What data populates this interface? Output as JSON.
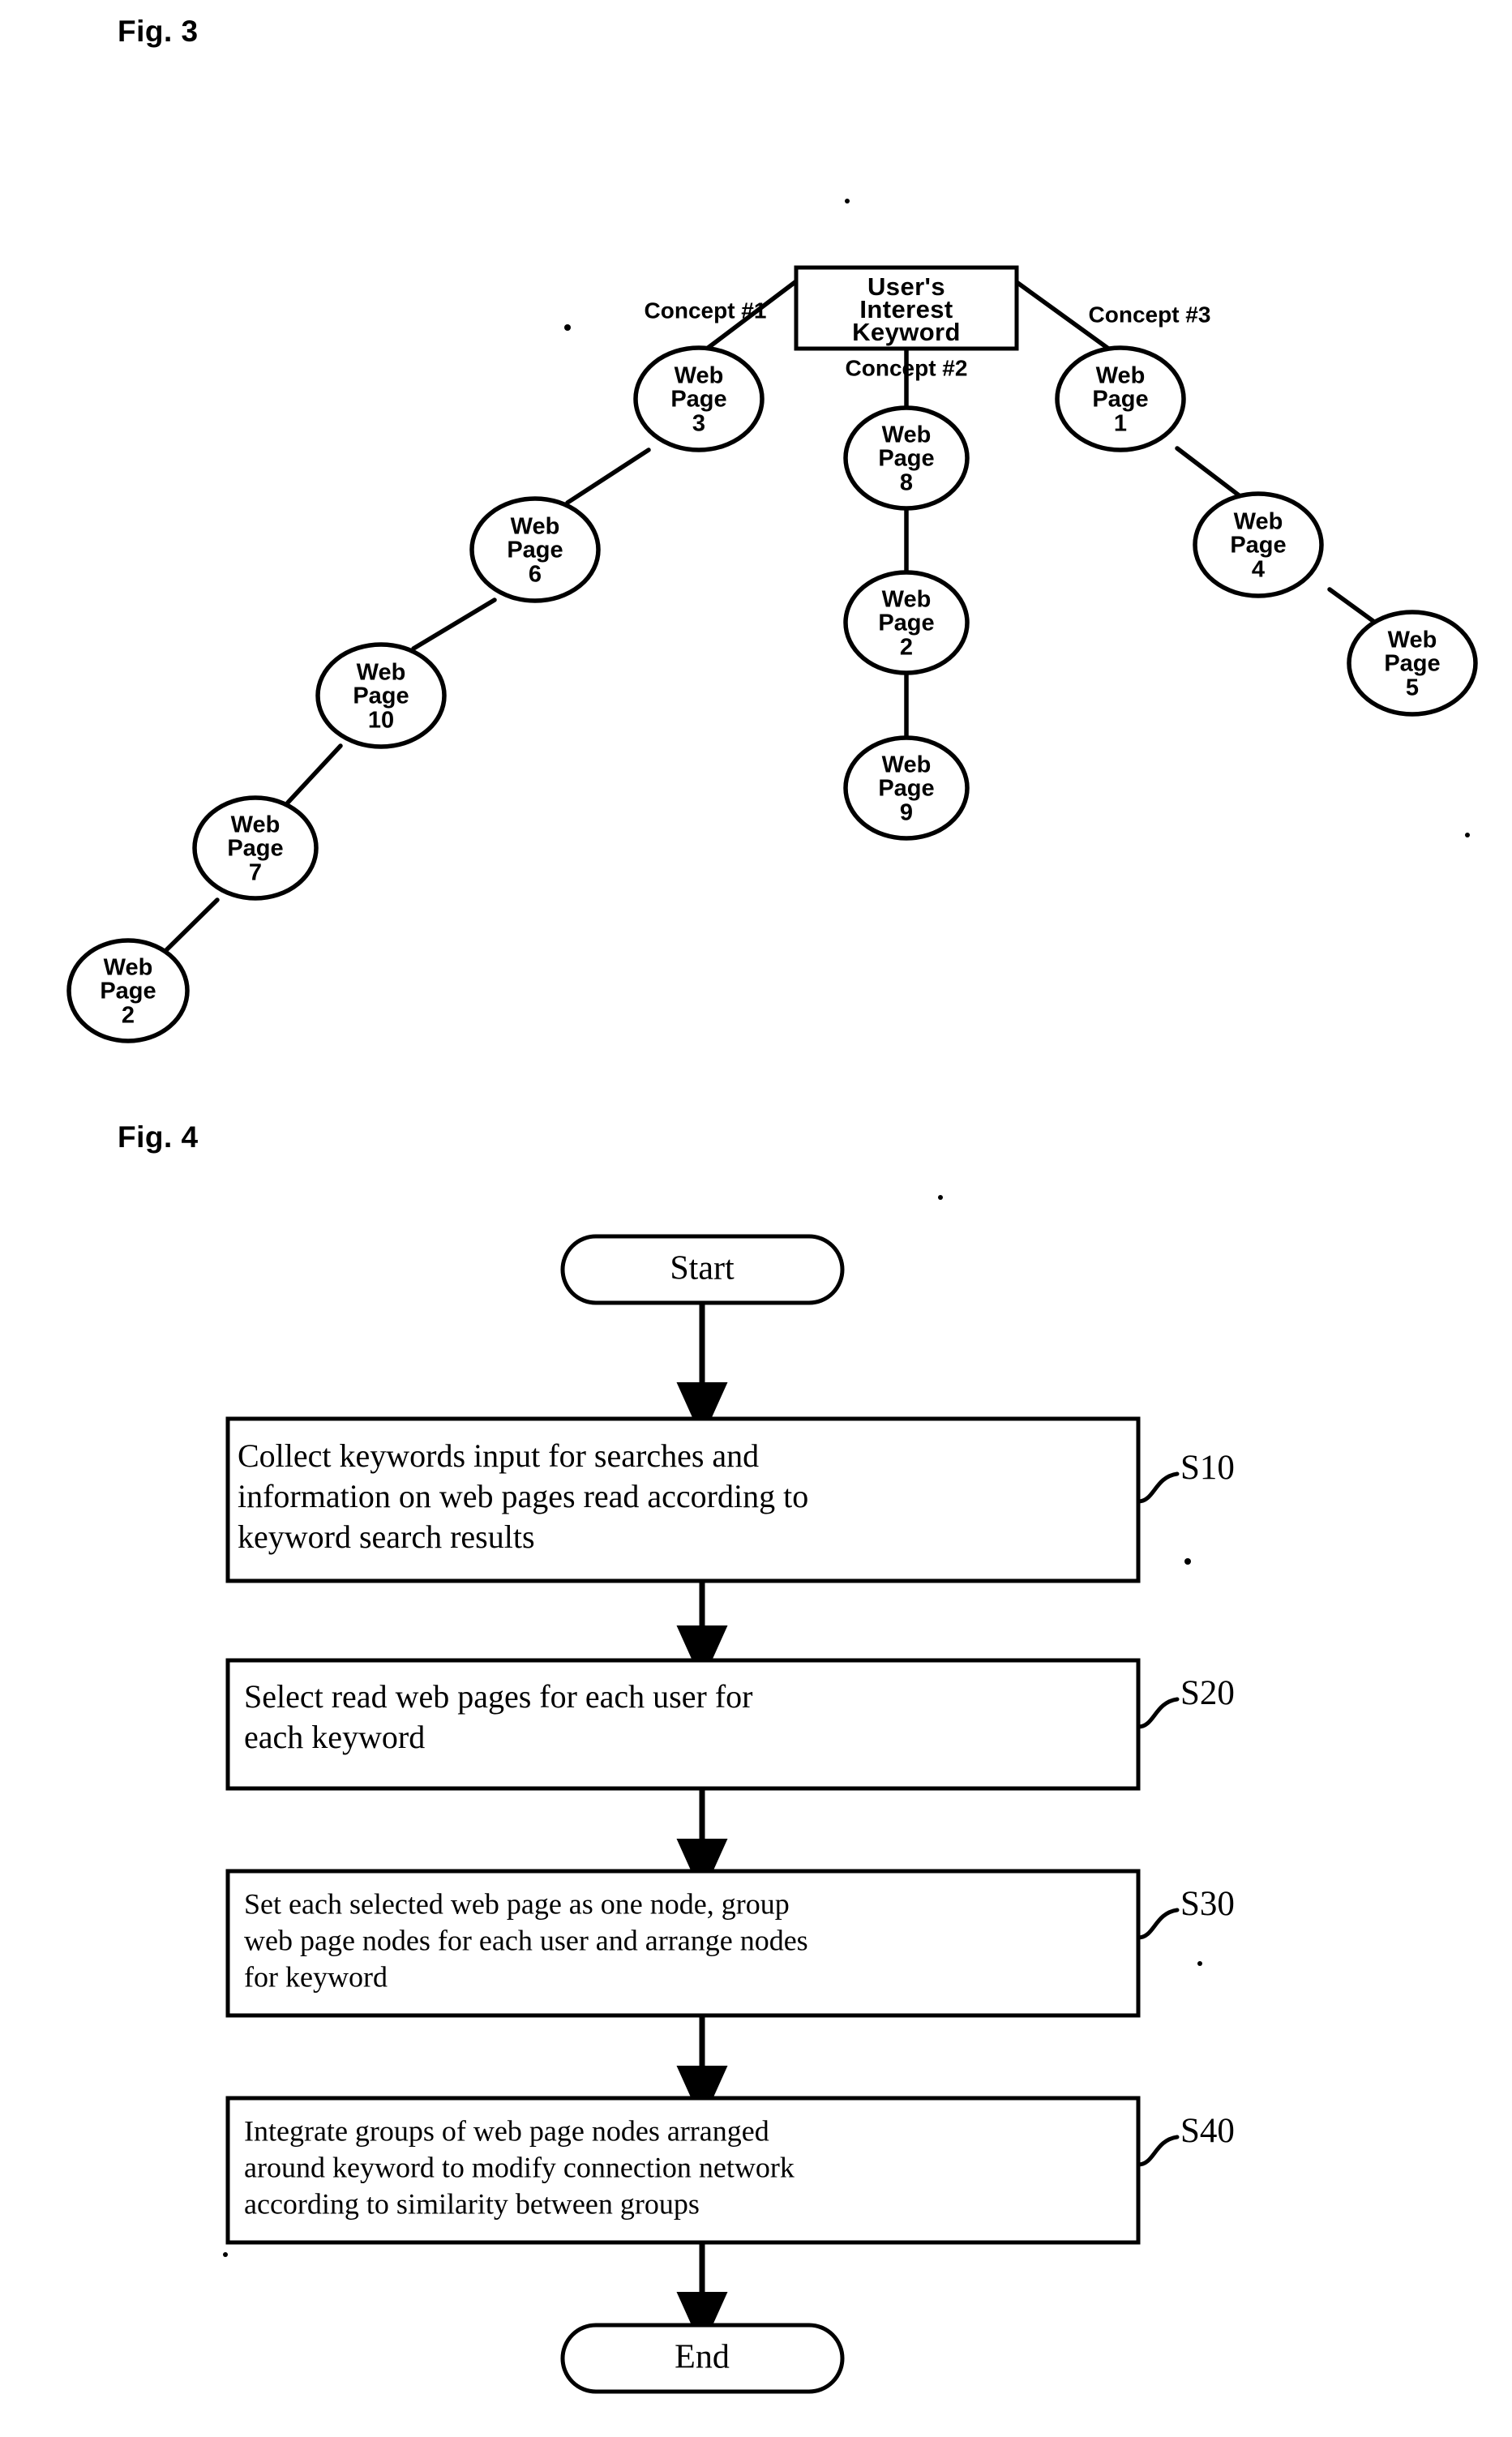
{
  "figures": [
    {
      "caption": "Fig. 3",
      "type": "node-network-diagram",
      "center": {
        "label": "User's Interest Keyword",
        "lines": [
          "User's",
          "Interest",
          "Keyword"
        ]
      },
      "branches": [
        {
          "concept_label": "Concept #1",
          "nodes": [
            "Web Page 3",
            "Web Page 6",
            "Web Page 10",
            "Web Page 7",
            "Web Page 2"
          ],
          "node_numbers": [
            "3",
            "6",
            "10",
            "7",
            "2"
          ]
        },
        {
          "concept_label": "Concept #2",
          "nodes": [
            "Web Page 8",
            "Web Page 2",
            "Web Page 9"
          ],
          "node_numbers": [
            "8",
            "2",
            "9"
          ]
        },
        {
          "concept_label": "Concept #3",
          "nodes": [
            "Web Page 1",
            "Web Page 4",
            "Web Page 5"
          ],
          "node_numbers": [
            "1",
            "4",
            "5"
          ]
        }
      ],
      "node_line1": "Web",
      "node_line2": "Page"
    },
    {
      "caption": "Fig. 4",
      "type": "flowchart",
      "start_label": "Start",
      "end_label": "End",
      "steps": [
        {
          "id": "S10",
          "lines": [
            "Collect keywords input for searches and",
            "information on web pages read according to",
            "keyword search results"
          ]
        },
        {
          "id": "S20",
          "lines": [
            "Select read web pages for each user for",
            "each keyword"
          ]
        },
        {
          "id": "S30",
          "lines": [
            "Set each selected web page as one node, group",
            "web page nodes for each user and arrange nodes",
            "for keyword"
          ]
        },
        {
          "id": "S40",
          "lines": [
            "Integrate groups of web page nodes arranged",
            "around keyword to modify connection network",
            "according to similarity between groups"
          ]
        }
      ]
    }
  ],
  "colors": {
    "ink": "#000000",
    "paper": "#ffffff"
  }
}
